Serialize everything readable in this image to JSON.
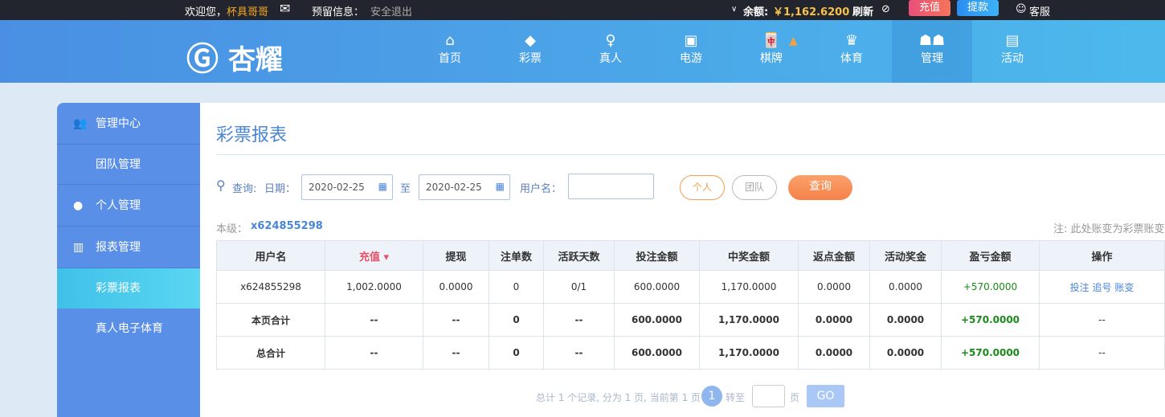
{
  "topbar": {
    "welcome": "欢迎您，",
    "username": "杯具哥哥",
    "reserve": "预留信息：",
    "logout": "安全退出",
    "balance_label": "余额:",
    "balance": "￥1,162.6200",
    "refresh": "刷新",
    "deposit": "充值",
    "withdraw": "提款",
    "service": "客服"
  },
  "logo": "杏耀",
  "nav": [
    {
      "label": "首页",
      "icon": "home-icon"
    },
    {
      "label": "彩票",
      "icon": "ticket-icon"
    },
    {
      "label": "真人",
      "icon": "person-icon"
    },
    {
      "label": "电游",
      "icon": "slot-icon"
    },
    {
      "label": "棋牌",
      "icon": "mahjong-icon"
    },
    {
      "label": "体育",
      "icon": "trophy-icon"
    },
    {
      "label": "管理",
      "icon": "users-icon"
    },
    {
      "label": "活动",
      "icon": "gift-icon"
    }
  ],
  "sidebar": [
    {
      "label": "管理中心"
    },
    {
      "label": "团队管理"
    },
    {
      "label": "个人管理"
    },
    {
      "label": "报表管理"
    },
    {
      "label": "彩票报表"
    },
    {
      "label": "真人电子体育"
    }
  ],
  "page": {
    "title": "彩票报表",
    "query": "查询:",
    "date_label": "日期：",
    "date_from": "2020-02-25",
    "to": "至",
    "date_to": "2020-02-25",
    "username_label": "用户名：",
    "username_value": "",
    "personal": "个人",
    "team": "团队",
    "search": "查询",
    "level_label": "本级：",
    "level_user": "x624855298",
    "note": "注: 此处账变为彩票账变"
  },
  "table": {
    "headers": [
      "用户名",
      "充值",
      "提现",
      "注单数",
      "活跃天数",
      "投注金额",
      "中奖金额",
      "返点金额",
      "活动奖金",
      "盈亏金额",
      "操作"
    ],
    "rows": [
      [
        "x624855298",
        "1,002.0000",
        "0.0000",
        "0",
        "0/1",
        "600.0000",
        "1,170.0000",
        "0.0000",
        "0.0000",
        "+570.0000"
      ],
      [
        "本页合计",
        "--",
        "--",
        "0",
        "--",
        "600.0000",
        "1,170.0000",
        "0.0000",
        "0.0000",
        "+570.0000",
        "--"
      ],
      [
        "总合计",
        "--",
        "--",
        "0",
        "--",
        "600.0000",
        "1,170.0000",
        "0.0000",
        "0.0000",
        "+570.0000",
        "--"
      ]
    ],
    "actions": [
      "投注",
      "追号",
      "账变"
    ]
  },
  "pager": {
    "summary": "总计 1 个记录, 分为 1 页, 当前第 1 页",
    "current": "1",
    "goto": "转至",
    "page": "页",
    "go": "GO"
  }
}
